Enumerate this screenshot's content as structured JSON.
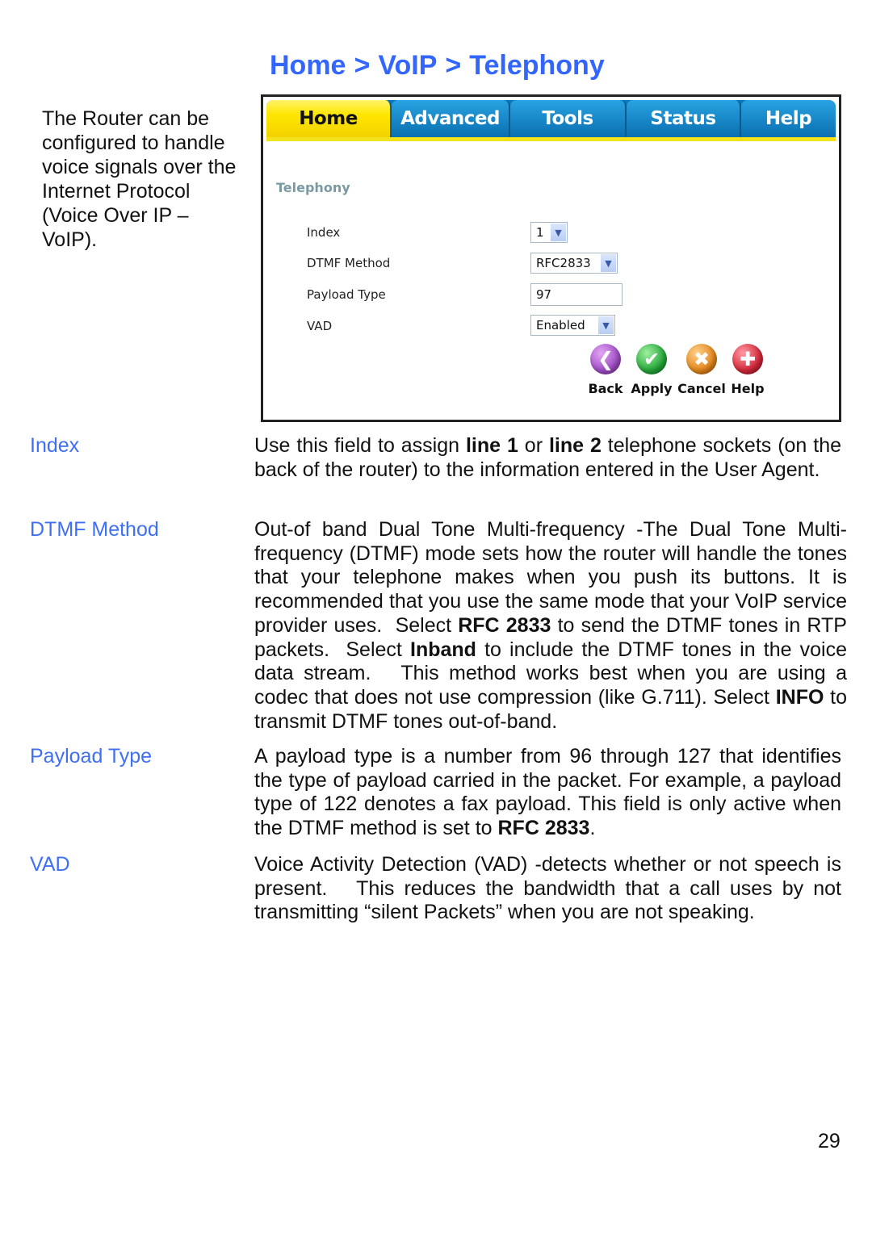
{
  "breadcrumb": [
    "Home",
    "VoIP",
    "Telephony"
  ],
  "breadcrumb_separator": ">",
  "intro": "The Router can be configured to handle voice signals over the Internet Protocol (Voice Over IP – VoIP).",
  "screenshot": {
    "tabs": [
      {
        "label": "Home",
        "active": true
      },
      {
        "label": "Advanced",
        "active": false
      },
      {
        "label": "Tools",
        "active": false
      },
      {
        "label": "Status",
        "active": false
      },
      {
        "label": "Help",
        "active": false
      }
    ],
    "section_title": "Telephony",
    "fields": [
      {
        "label": "Index",
        "value": "1",
        "type": "select"
      },
      {
        "label": "DTMF Method",
        "value": "RFC2833",
        "type": "select"
      },
      {
        "label": "Payload Type",
        "value": "97",
        "type": "text"
      },
      {
        "label": "VAD",
        "value": "Enabled",
        "type": "select"
      }
    ],
    "actions": [
      {
        "label": "Back",
        "icon": "back-arrow-icon",
        "color": "#a04fc6"
      },
      {
        "label": "Apply",
        "icon": "checkmark-icon",
        "color": "#27a83a"
      },
      {
        "label": "Cancel",
        "icon": "x-icon",
        "color": "#e3881d"
      },
      {
        "label": "Help",
        "icon": "plus-icon",
        "color": "#d4283a"
      }
    ]
  },
  "definitions": [
    {
      "term": "Index",
      "parts": [
        [
          "Use this field to assign ",
          false
        ],
        [
          "line 1",
          true
        ],
        [
          " or ",
          false
        ],
        [
          "line 2",
          true
        ],
        [
          " telephone sockets (on the back of the router) to the information entered in the User Agent.",
          false
        ]
      ]
    },
    {
      "term": "DTMF Method",
      "parts": [
        [
          "Out-of band Dual Tone Multi-frequency -The Dual Tone Multi-frequency (DTMF) mode sets how the router will handle the tones that your telephone makes when you push its buttons. It is recommended that you use the same mode that your VoIP service provider uses.  Select ",
          false
        ],
        [
          "RFC 2833",
          true
        ],
        [
          " to send the DTMF tones in RTP packets.  Select ",
          false
        ],
        [
          "Inband",
          true
        ],
        [
          " to include the DTMF tones in the voice data stream.   This method works best when you are using a codec that does not use compression (like G.711). Select ",
          false
        ],
        [
          "INFO",
          true
        ],
        [
          " to transmit DTMF tones out-of-band.",
          false
        ]
      ]
    },
    {
      "term": "Payload Type",
      "parts": [
        [
          "A payload type is a number from 96 through 127 that identifies the type of payload carried in the packet. For example, a payload type of 122 denotes a fax payload. This field is only active when the DTMF method is set to ",
          false
        ],
        [
          "RFC 2833",
          true
        ],
        [
          ".",
          false
        ]
      ]
    },
    {
      "term": "VAD",
      "parts": [
        [
          "Voice Activity Detection (VAD) -detects whether or not speech is present.   This reduces the bandwidth that a call uses by not transmitting “silent Packets” when you are not speaking.",
          false
        ]
      ]
    }
  ],
  "page_number": "29"
}
